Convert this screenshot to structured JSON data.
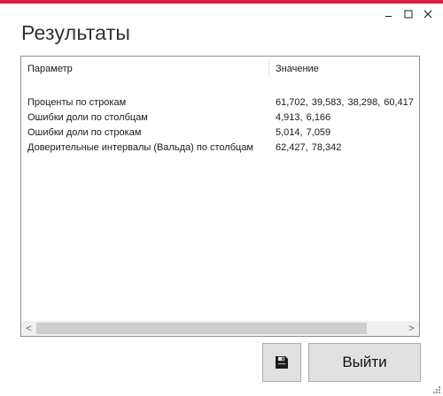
{
  "colors": {
    "accent": "#dc1e3c",
    "button_bg": "#e1e1e1",
    "scroll_thumb": "#cdcdcd"
  },
  "window": {
    "title": "Результаты",
    "controls": {
      "minimize_icon": "minimize-icon",
      "maximize_icon": "maximize-icon",
      "close_icon": "close-icon"
    }
  },
  "grid": {
    "columns": {
      "parameter": "Параметр",
      "value": "Значение"
    },
    "rows": [
      {
        "parameter": "Проценты по строкам",
        "value": "61,702,  39,583,  38,298,  60,417"
      },
      {
        "parameter": "Ошибки доли по столбцам",
        "value": "4,913,  6,166"
      },
      {
        "parameter": "Ошибки доли по строкам",
        "value": "5,014,  7,059"
      },
      {
        "parameter": "Доверительные интервалы (Вальда) по столбцам",
        "value": "62,427,  78,342"
      }
    ],
    "scrollbar": {
      "left_arrow": "<",
      "right_arrow": ">"
    }
  },
  "buttons": {
    "save_icon": "floppy-disk-icon",
    "exit_label": "Выйти"
  }
}
